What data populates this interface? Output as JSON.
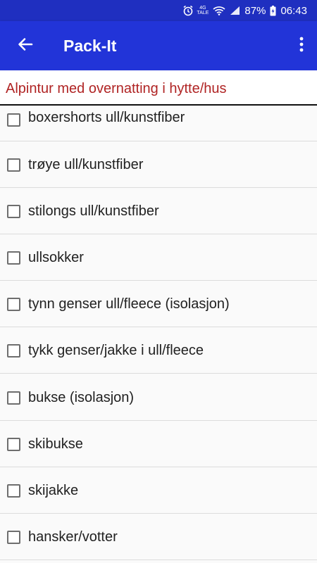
{
  "status_bar": {
    "network_top": "4G",
    "network_bottom": "TALE",
    "battery": "87%",
    "time": "06:43",
    "icons": [
      "alarm-icon",
      "volte-icon",
      "wifi-icon",
      "signal-icon",
      "battery-icon"
    ]
  },
  "app_bar": {
    "title": "Pack-It",
    "back_icon": "arrow-back-icon",
    "menu_icon": "more-vert-icon",
    "color": "#2234d8"
  },
  "subheader": {
    "text": "Alpintur med overnatting i hytte/hus",
    "color": "#b02424"
  },
  "items": [
    {
      "label": "boxershorts ull/kunstfiber",
      "checked": false
    },
    {
      "label": "trøye ull/kunstfiber",
      "checked": false
    },
    {
      "label": "stilongs ull/kunstfiber",
      "checked": false
    },
    {
      "label": "ullsokker",
      "checked": false
    },
    {
      "label": "tynn genser ull/fleece (isolasjon)",
      "checked": false
    },
    {
      "label": "tykk genser/jakke i ull/fleece",
      "checked": false
    },
    {
      "label": "bukse (isolasjon)",
      "checked": false
    },
    {
      "label": "skibukse",
      "checked": false
    },
    {
      "label": "skijakke",
      "checked": false
    },
    {
      "label": "hansker/votter",
      "checked": false
    }
  ]
}
